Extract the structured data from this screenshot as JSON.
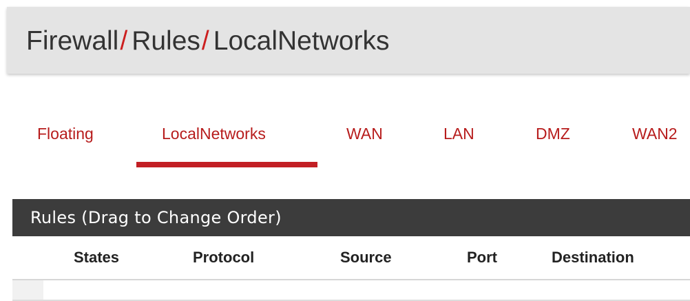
{
  "breadcrumb": {
    "items": [
      "Firewall",
      "Rules",
      "LocalNetworks"
    ],
    "separator": "/"
  },
  "tabs": [
    {
      "label": "Floating",
      "active": false
    },
    {
      "label": "LocalNetworks",
      "active": true
    },
    {
      "label": "WAN",
      "active": false
    },
    {
      "label": "LAN",
      "active": false
    },
    {
      "label": "DMZ",
      "active": false
    },
    {
      "label": "WAN2",
      "active": false
    }
  ],
  "panel": {
    "title": "Rules (Drag to Change Order)",
    "columns": [
      "States",
      "Protocol",
      "Source",
      "Port",
      "Destination"
    ]
  },
  "colors": {
    "accent": "#c21f24",
    "tab_text": "#b71c1c",
    "header_bg": "#e4e4e4",
    "panel_heading_bg": "#3c3c3c"
  }
}
